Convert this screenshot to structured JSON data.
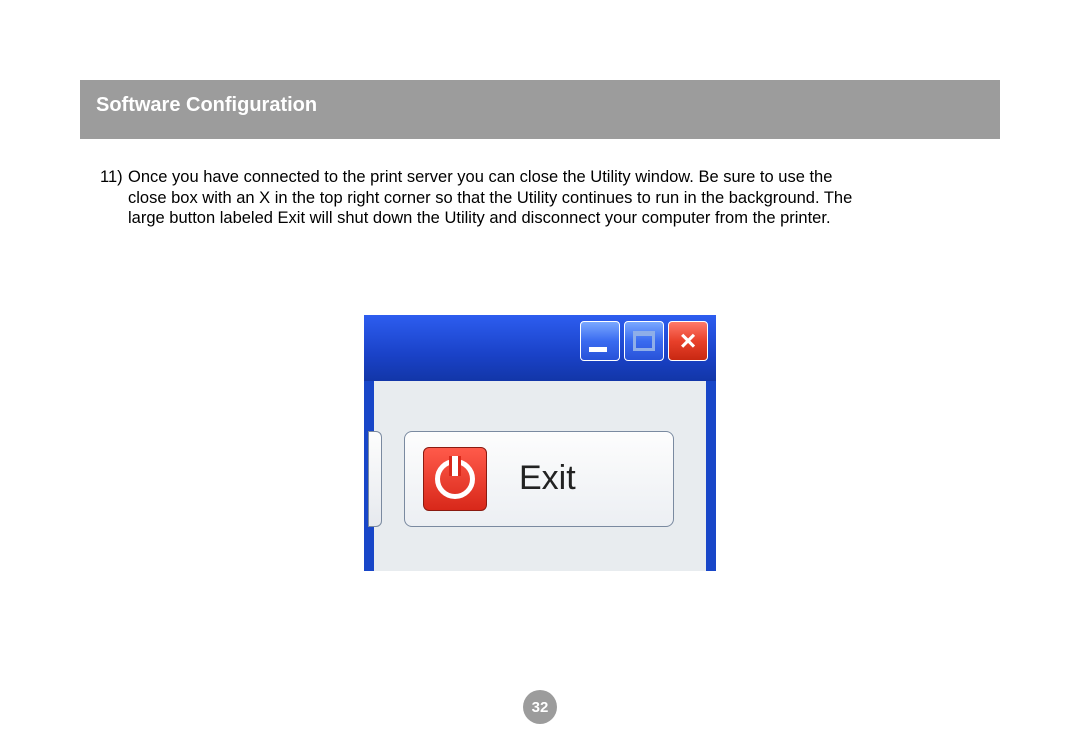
{
  "header": {
    "title": "Software Configuration"
  },
  "step": {
    "number": "11)",
    "line1": "Once you have connected to the print server you can close the Utility window.  Be sure to use the",
    "line2": "close box with an X in the top right corner so that the Utility continues to run in the background.  The",
    "line3": "large button labeled Exit will shut down the Utility and disconnect your computer from the printer."
  },
  "screenshot": {
    "close_glyph": "×",
    "exit_label": "Exit"
  },
  "page_number": "32"
}
